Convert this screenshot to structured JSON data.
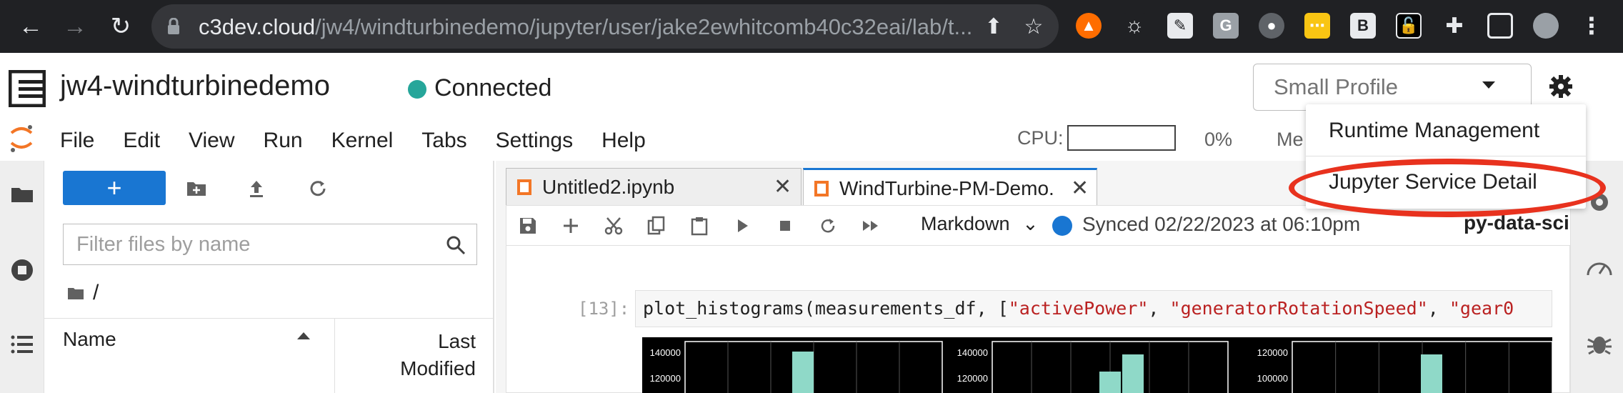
{
  "browser": {
    "url_host": "c3dev.cloud",
    "url_path": "/jw4/windturbinedemo/jupyter/user/jake2ewhitcomb40c32eai/lab/t..."
  },
  "app": {
    "title": "jw4-windturbinedemo",
    "status": "Connected",
    "status_color": "#26a69a",
    "profile_select": "Small Profile"
  },
  "menu": {
    "items": [
      "File",
      "Edit",
      "View",
      "Run",
      "Kernel",
      "Tabs",
      "Settings",
      "Help"
    ]
  },
  "resources": {
    "cpu_label": "CPU:",
    "cpu_percent": "0%",
    "mem_label": "Me"
  },
  "dropdown": {
    "items": [
      "Runtime Management",
      "Jupyter Service Detail"
    ]
  },
  "filebrowser": {
    "filter_placeholder": "Filter files by name",
    "breadcrumb": "/",
    "col_name": "Name",
    "col_last_1": "Last",
    "col_last_2": "Modified"
  },
  "tabs": [
    {
      "label": "Untitled2.ipynb",
      "active": false
    },
    {
      "label": "WindTurbine-PM-Demo.",
      "active": true
    }
  ],
  "notebook": {
    "cell_type": "Markdown",
    "sync_status": "Synced 02/22/2023 at 06:10pm",
    "kernel": "py-data-sci",
    "prompt": "[13]:",
    "code_prefix": "plot_histograms(measurements_df, [",
    "code_str1": "\"activePower\"",
    "code_sep1": ", ",
    "code_str2": "\"generatorRotationSpeed\"",
    "code_sep2": ", ",
    "code_str3": "\"gear0"
  },
  "plot": {
    "panels": [
      {
        "ticks": [
          "140000",
          "120000"
        ]
      },
      {
        "ticks": [
          "140000",
          "120000",
          "100000"
        ]
      },
      {
        "ticks": [
          "120000",
          "100000"
        ]
      }
    ],
    "bar_color": "#8fd9c8"
  },
  "icons": {
    "accent": "#1976d2",
    "annotation": "#e8321e"
  }
}
